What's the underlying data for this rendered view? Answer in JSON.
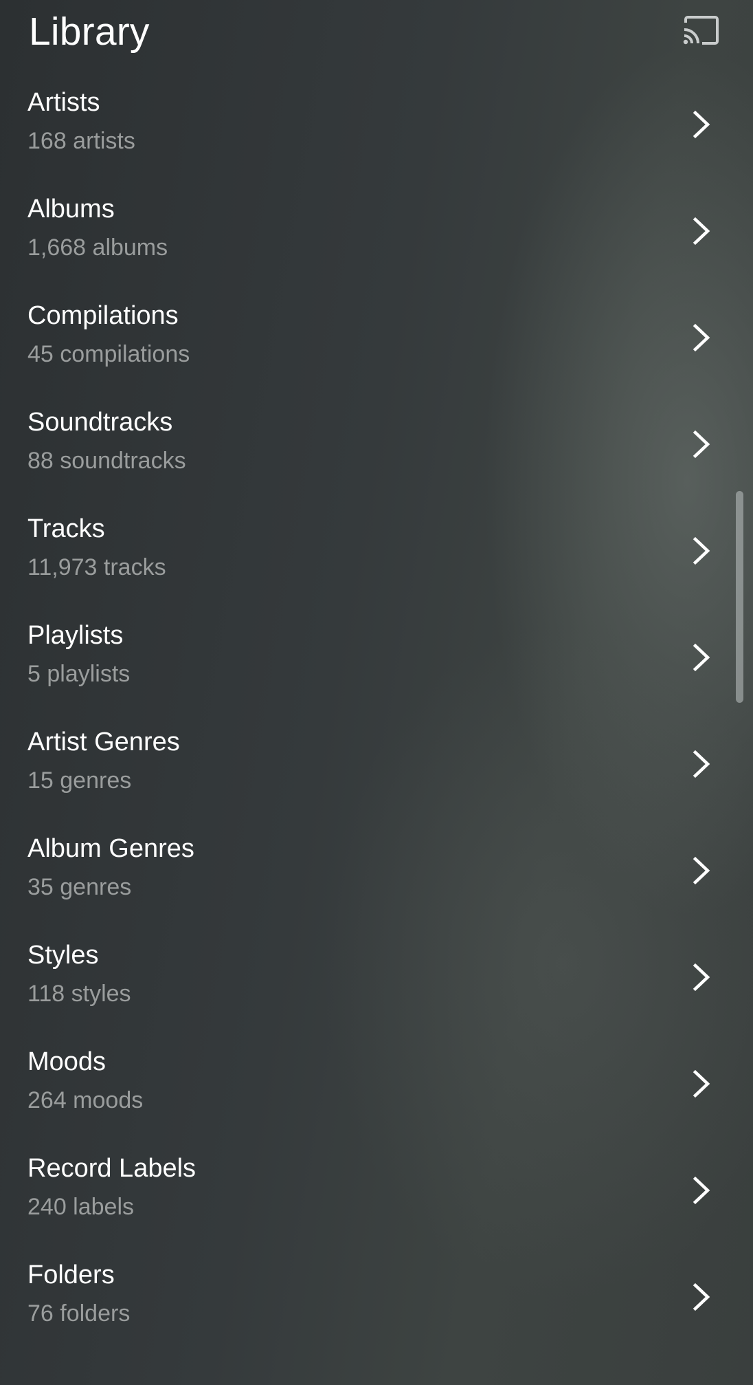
{
  "header": {
    "title": "Library",
    "cast_icon": "cast-icon"
  },
  "library": {
    "items": [
      {
        "title": "Artists",
        "count": "168 artists"
      },
      {
        "title": "Albums",
        "count": "1,668 albums"
      },
      {
        "title": "Compilations",
        "count": "45 compilations"
      },
      {
        "title": "Soundtracks",
        "count": "88 soundtracks"
      },
      {
        "title": "Tracks",
        "count": "11,973 tracks"
      },
      {
        "title": "Playlists",
        "count": "5 playlists"
      },
      {
        "title": "Artist Genres",
        "count": "15 genres"
      },
      {
        "title": "Album Genres",
        "count": "35 genres"
      },
      {
        "title": "Styles",
        "count": "118 styles"
      },
      {
        "title": "Moods",
        "count": "264 moods"
      },
      {
        "title": "Record Labels",
        "count": "240 labels"
      },
      {
        "title": "Folders",
        "count": "76 folders"
      }
    ],
    "chevron_icon": "chevron-right-icon"
  },
  "colors": {
    "title_text": "#ffffff",
    "secondary_text": "#9a9d9d",
    "background": "#33373a"
  }
}
